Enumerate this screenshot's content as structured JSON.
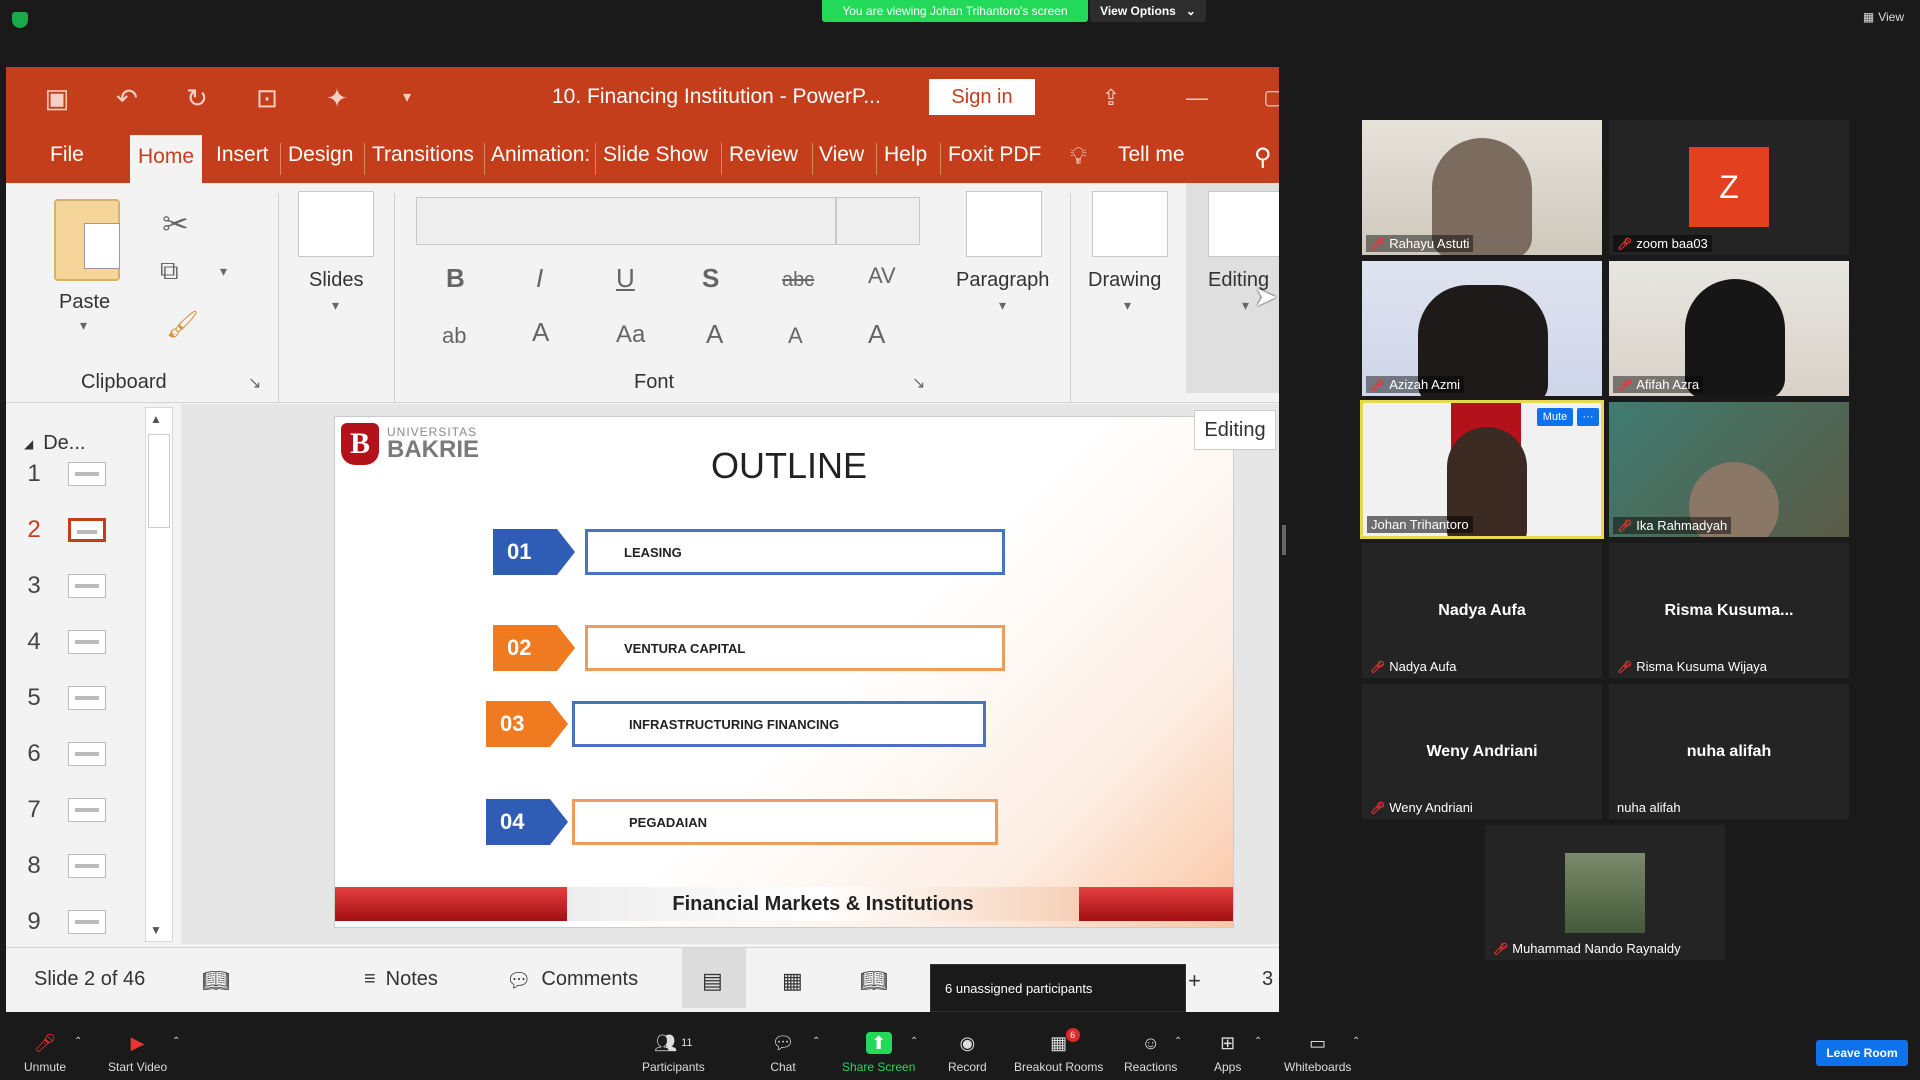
{
  "top": {
    "banner": "You are viewing Johan Trihantoro's screen",
    "view_options": "View Options",
    "view": "View"
  },
  "ppt": {
    "title": "10. Financing Institution  -  PowerP...",
    "sign_in": "Sign in",
    "tabs": [
      "File",
      "Home",
      "Insert",
      "Design",
      "Transitions",
      "Animation:",
      "Slide Show",
      "Review",
      "View",
      "Help",
      "Foxit PDF",
      "Tell me"
    ],
    "ribbon": {
      "paste": "Paste",
      "clipboard": "Clipboard",
      "slides": "Slides",
      "font": "Font",
      "paragraph": "Paragraph",
      "drawing": "Drawing",
      "editing": "Editing"
    },
    "thumb_section": "De...",
    "thumb_numbers": [
      "1",
      "2",
      "3",
      "4",
      "5",
      "6",
      "7",
      "8",
      "9"
    ],
    "editing_tooltip": "Editing",
    "slide": {
      "logo_line1": "UNIVERSITAS",
      "logo_line2": "BAKRIE",
      "logo_letter": "B",
      "title": "OUTLINE",
      "items": [
        {
          "num": "01",
          "label": "LEASING",
          "color": "#2f5db5"
        },
        {
          "num": "02",
          "label": "VENTURA CAPITAL",
          "color": "#ef7a1f"
        },
        {
          "num": "03",
          "label": "INFRASTRUCTURING FINANCING",
          "color": "#ef7a1f"
        },
        {
          "num": "04",
          "label": "PEGADAIAN",
          "color": "#2f5db5"
        }
      ],
      "footer": "Financial Markets & Institutions"
    },
    "status": {
      "slide_of": "Slide 2 of 46",
      "notes": "Notes",
      "comments": "Comments",
      "zoom_partial": "3"
    }
  },
  "tooltip_unassigned": "6 unassigned participants",
  "participants": [
    {
      "name": "Rahayu Astuti"
    },
    {
      "name": "zoom baa03",
      "avatar": "Z"
    },
    {
      "name": "Azizah Azmi"
    },
    {
      "name": "Afifah Azra"
    },
    {
      "name": "Johan Trihantoro",
      "mute": "Mute",
      "more": "···"
    },
    {
      "name": "Ika Rahmadyah"
    },
    {
      "name": "Nadya Aufa",
      "center": "Nadya Aufa"
    },
    {
      "name": "Risma Kusuma Wijaya",
      "center": "Risma  Kusuma..."
    },
    {
      "name": "Weny Andriani",
      "center": "Weny Andriani"
    },
    {
      "name": "nuha alifah",
      "center": "nuha alifah"
    },
    {
      "name": "Muhammad Nando Raynaldy"
    }
  ],
  "toolbar": {
    "unmute": "Unmute",
    "start_video": "Start Video",
    "participants": "Participants",
    "participants_count": "11",
    "chat": "Chat",
    "share_screen": "Share Screen",
    "record": "Record",
    "breakout_rooms": "Breakout Rooms",
    "breakout_count": "6",
    "reactions": "Reactions",
    "apps": "Apps",
    "whiteboards": "Whiteboards",
    "leave_room": "Leave Room"
  },
  "colors": {
    "ppt_red": "#c43e1c",
    "zoom_green": "#23d959",
    "zoom_blue": "#0e72ed",
    "active_speaker": "#e6d94b"
  }
}
